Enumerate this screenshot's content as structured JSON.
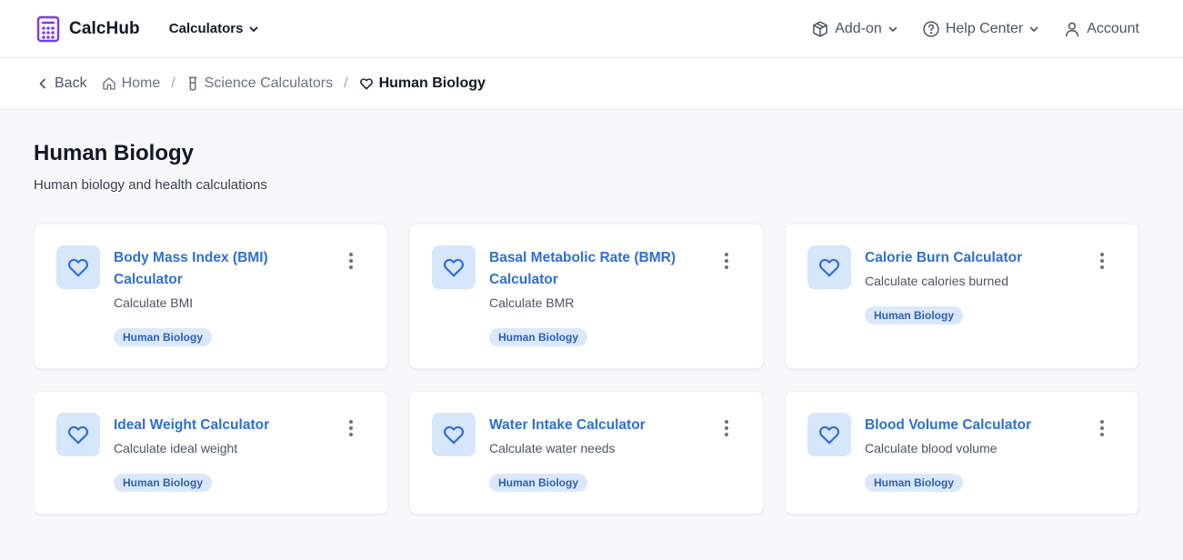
{
  "brand": {
    "name": "CalcHub",
    "color": "#7c3aed",
    "icon": "calculator-icon"
  },
  "nav": {
    "calculators_label": "Calculators",
    "addon_label": "Add-on",
    "help_label": "Help Center",
    "account_label": "Account"
  },
  "breadcrumb": {
    "back_label": "Back",
    "items": [
      {
        "label": "Home",
        "icon": "home-icon"
      },
      {
        "label": "Science Calculators",
        "icon": "flask-icon"
      },
      {
        "label": "Human Biology",
        "icon": "heart-icon"
      }
    ]
  },
  "page": {
    "title": "Human Biology",
    "subtitle": "Human biology and health calculations"
  },
  "colors": {
    "accent": "#2f6fd6",
    "icon_bg": "#d6e6fb",
    "tag_bg": "#dbe8fb"
  },
  "cards": [
    {
      "title": "Body Mass Index (BMI) Calculator",
      "description": "Calculate BMI",
      "tag": "Human Biology",
      "icon": "heart-icon"
    },
    {
      "title": "Basal Metabolic Rate (BMR) Calculator",
      "description": "Calculate BMR",
      "tag": "Human Biology",
      "icon": "heart-icon"
    },
    {
      "title": "Calorie Burn Calculator",
      "description": "Calculate calories burned",
      "tag": "Human Biology",
      "icon": "heart-icon"
    },
    {
      "title": "Ideal Weight Calculator",
      "description": "Calculate ideal weight",
      "tag": "Human Biology",
      "icon": "heart-icon"
    },
    {
      "title": "Water Intake Calculator",
      "description": "Calculate water needs",
      "tag": "Human Biology",
      "icon": "heart-icon"
    },
    {
      "title": "Blood Volume Calculator",
      "description": "Calculate blood volume",
      "tag": "Human Biology",
      "icon": "heart-icon"
    }
  ]
}
